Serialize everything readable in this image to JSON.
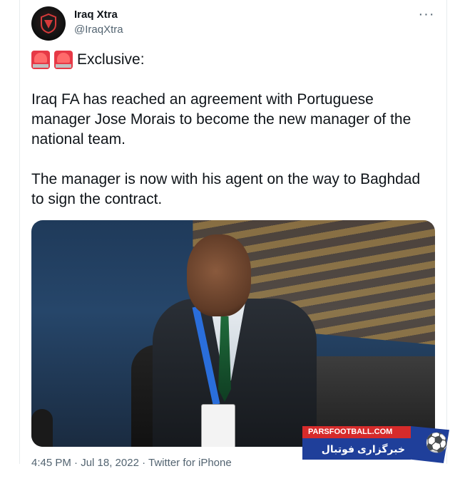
{
  "tweet": {
    "author_name": "Iraq Xtra",
    "author_handle": "@IraqXtra",
    "more_icon": "more-horizontal-icon",
    "line1": "Exclusive:",
    "paragraph1": "Iraq FA has reached an agreement with Portuguese manager Jose Morais to become the new manager of the national team.",
    "paragraph2": "The manager is now with his agent on the way to Baghdad to sign the contract.",
    "footer": "4:45 PM · Jul 18, 2022 · Twitter for iPhone"
  },
  "watermark": {
    "top": "PARSFOOTBALL.COM",
    "bottom": "خبرگزاری فوتبال ایران"
  },
  "colors": {
    "text": "#0f1419",
    "secondary": "#536471",
    "siren": "#e63946",
    "watermark_red": "#d62b2b",
    "watermark_blue": "#1f3f9a"
  }
}
